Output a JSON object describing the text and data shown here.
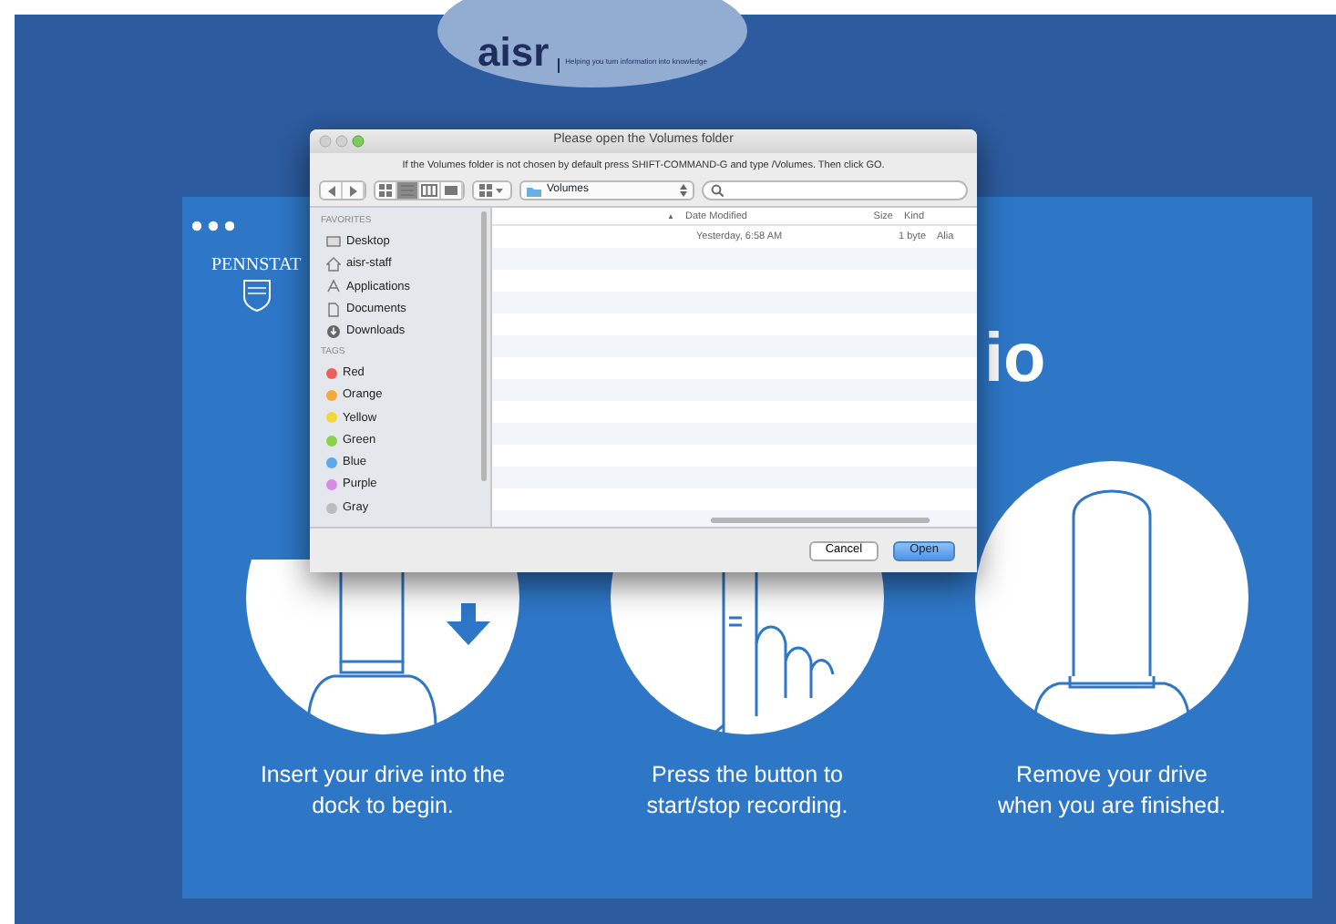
{
  "logo": {
    "name": "aisr",
    "tagline": "Helping you turn information into knowledge"
  },
  "app": {
    "brand": "PENNSTAT",
    "title_fragment": "io",
    "steps": [
      {
        "kind": "insert",
        "caption": "Insert your drive into the dock to begin."
      },
      {
        "kind": "press",
        "caption": "Press the button to start/stop recording."
      },
      {
        "kind": "remove",
        "caption": "Remove your drive when you are finished."
      }
    ]
  },
  "dialog": {
    "title": "Please open the Volumes folder",
    "message": "If the Volumes folder is not chosen by default press SHIFT-COMMAND-G and type /Volumes. Then click GO.",
    "view_modes": [
      {
        "selected": false
      },
      {
        "selected": true
      },
      {
        "selected": false
      },
      {
        "selected": false
      }
    ],
    "location": "Volumes",
    "sidebar": {
      "favorites_heading": "FAVORITES",
      "favorites": [
        {
          "kind": "desktop",
          "label": "Desktop"
        },
        {
          "kind": "home",
          "label": "aisr-staff"
        },
        {
          "kind": "applications",
          "label": "Applications"
        },
        {
          "kind": "documents",
          "label": "Documents"
        },
        {
          "kind": "downloads",
          "label": "Downloads"
        }
      ],
      "tags_heading": "TAGS",
      "tags": [
        {
          "label": "Red",
          "color": "#f0605a"
        },
        {
          "label": "Orange",
          "color": "#f6a93b"
        },
        {
          "label": "Yellow",
          "color": "#f2d63c"
        },
        {
          "label": "Green",
          "color": "#8bd24c"
        },
        {
          "label": "Blue",
          "color": "#5aa8ee"
        },
        {
          "label": "Purple",
          "color": "#d88ae6"
        },
        {
          "label": "Gray",
          "color": "#bdbdbd"
        }
      ]
    },
    "columns": [
      {
        "label": "▲"
      },
      {
        "label": "Date Modified"
      },
      {
        "label": "Size"
      },
      {
        "label": "Kind"
      }
    ],
    "rows": [
      {
        "date": "Yesterday, 6:58 AM",
        "size": "1 byte",
        "kind": "Alia"
      }
    ],
    "buttons": [
      {
        "label": "Cancel",
        "default": false
      },
      {
        "label": "Open",
        "default": true
      }
    ]
  }
}
